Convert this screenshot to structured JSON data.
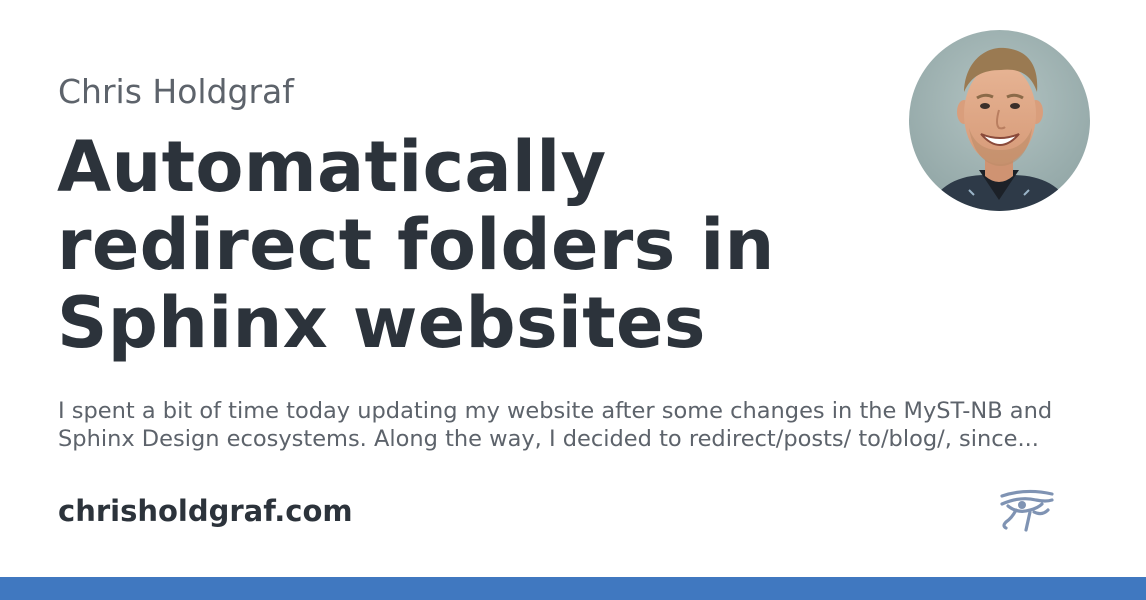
{
  "card": {
    "author": "Chris Holdgraf",
    "title": "Automatically redirect folders in Sphinx websites",
    "description": "I spent a bit of time today updating my website after some changes in the MyST-NB and Sphinx Design ecosystems. Along the way, I decided to redirect/posts/ to/blog/, since...",
    "site": "chrisholdgraf.com"
  },
  "icons": {
    "avatar": "author-photo",
    "logo": "eye-of-horus-icon"
  },
  "colors": {
    "title": "#2c333b",
    "muted_text": "#5d636b",
    "accent_bar": "#4078c0",
    "logo": "#7f93b3"
  }
}
